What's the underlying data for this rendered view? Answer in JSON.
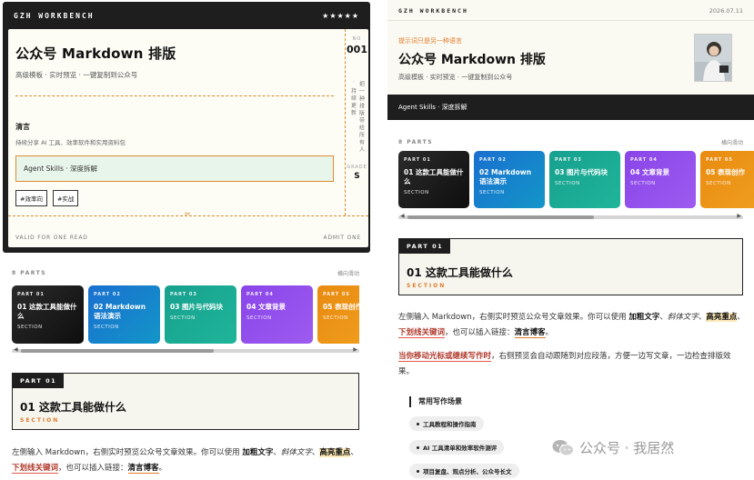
{
  "left": {
    "ticket": {
      "brand": "GZH WORKBENCH",
      "stars": "★★★★★",
      "title": "公众号 Markdown 排版",
      "subtitle": "高级模板 · 实时预览 · 一键复制到公众号",
      "author": "清言",
      "author_desc": "持续分享 AI 工具、效率软件和实用资料包",
      "agent_box": "Agent Skills · 深度拆解",
      "tags": [
        "#效率向",
        "#实战"
      ],
      "no_label": "NO",
      "no_value": "001",
      "vertical_text": "把一种排版带给所有人 · 持续更新",
      "grade_label": "GRADE",
      "grade_value": "S",
      "foot_left": "VALID FOR ONE READ",
      "foot_right": "ADMIT ONE"
    },
    "parts_label": "8 PARTS",
    "parts_hint": "横向滑动",
    "cards": [
      {
        "part": "PART 01",
        "title": "01 这款工具能做什么",
        "sec": "SECTION",
        "color": "dark"
      },
      {
        "part": "PART 02",
        "title": "02 Markdown 语法演示",
        "sec": "SECTION",
        "color": "blue"
      },
      {
        "part": "PART 03",
        "title": "03 图片与代码块",
        "sec": "SECTION",
        "color": "teal"
      },
      {
        "part": "PART 04",
        "title": "04 文章背景",
        "sec": "SECTION",
        "color": "purple"
      },
      {
        "part": "PART 05",
        "title": "05 表现创作",
        "sec": "SECTION",
        "color": "orange"
      }
    ],
    "section": {
      "tag": "PART 01",
      "title": "01 这款工具能做什么",
      "sub": "SECTION"
    },
    "para": {
      "t1": "左侧输入 Markdown，右侧实时预览公众号文章效果。你可以使用 ",
      "bold": "加粗文字",
      "t2": "、",
      "italic": "斜体文字",
      "t3": "、",
      "hl": "高亮重点",
      "t4": "、",
      "ul": "下划线关键词",
      "t5": "，也可以插入链接：",
      "link": "清言博客",
      "t6": "。"
    }
  },
  "right": {
    "brand": "GZH WORKBENCH",
    "date": "2026.07.11",
    "tagline": "提示词只是另一种语言",
    "title": "公众号 Markdown 排版",
    "subtitle": "高级模板 · 实时预览 · 一键复制到公众号",
    "bar": "Agent Skills · 深度拆解",
    "parts_label": "8 PARTS",
    "parts_hint": "横向滑动",
    "cards": [
      {
        "part": "PART 01",
        "title": "01 这款工具能做什么",
        "sec": "SECTION",
        "color": "dark"
      },
      {
        "part": "PART 02",
        "title": "02 Markdown 语法演示",
        "sec": "SECTION",
        "color": "blue"
      },
      {
        "part": "PART 03",
        "title": "03 图片与代码块",
        "sec": "SECTION",
        "color": "teal"
      },
      {
        "part": "PART 04",
        "title": "04 文章背景",
        "sec": "SECTION",
        "color": "purple"
      },
      {
        "part": "PART 05",
        "title": "05 表现创作",
        "sec": "SECTION",
        "color": "orange"
      }
    ],
    "section": {
      "tag": "PART 01",
      "title": "01 这款工具能做什么",
      "sub": "SECTION"
    },
    "para1": {
      "t1": "左侧输入 Markdown，右侧实时预览公众号文章效果。你可以使用 ",
      "bold": "加粗文字",
      "t2": "、",
      "italic": "斜体文字",
      "t3": "、",
      "hl": "高亮重点",
      "t4": "、",
      "ul": "下划线关键词",
      "t5": "，也可以插入链接：",
      "link": "清言博客",
      "t6": "。"
    },
    "para2": {
      "ul": "当你移动光标或继续写作时",
      "t1": "，右侧预览会自动跟随到对应段落，方便一边写文章，一边检查排版效果。"
    },
    "list_title": "常用写作场景",
    "chips": [
      "工具教程和操作指南",
      "AI 工具清单和效率软件测评",
      "项目复盘、观点分析、公众号长文"
    ],
    "watermark": "公众号 · 我居然"
  },
  "colors": {
    "dark": "#1c1c1c",
    "blue": "#1a6fd0",
    "teal": "#17a08e",
    "purple": "#8a45e8",
    "orange": "#e98b10",
    "accent": "#e07b2c"
  }
}
